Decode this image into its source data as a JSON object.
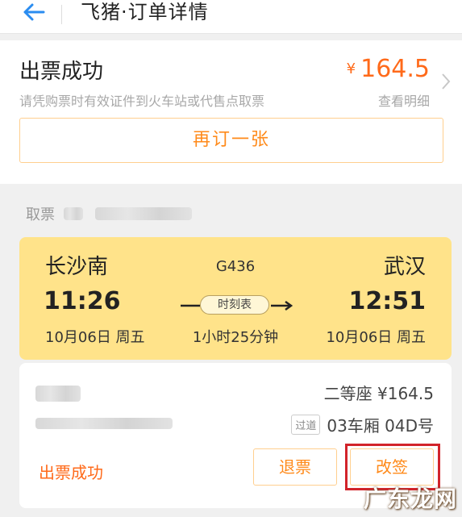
{
  "header": {
    "title": "飞猪·订单详情",
    "back_icon": "arrow-left-icon"
  },
  "status": {
    "title": "出票成功",
    "description": "请凭购票时有效证件到火车站或代售点取票",
    "currency": "¥",
    "price": "164.5",
    "detail_link": "查看明细",
    "rebook_label": "再订一张"
  },
  "pickup": {
    "label": "取票"
  },
  "train": {
    "from_station": "长沙南",
    "to_station": "武汉",
    "train_no": "G436",
    "departure_time": "11:26",
    "arrival_time": "12:51",
    "timetable_label": "时刻表",
    "departure_date": "10月06日 周五",
    "arrival_date": "10月06日 周五",
    "duration": "1小时25分钟"
  },
  "passenger": {
    "seat_price": "二等座 ¥164.5",
    "pass_badge": "过道",
    "car_seat": "03车厢 04D号",
    "ticket_status": "出票成功",
    "refund_label": "退票",
    "change_label": "改签"
  },
  "watermark": "广东龙网",
  "colors": {
    "accent": "#ff6a1a",
    "train_card": "#ffe38a",
    "highlight": "#d2232a",
    "back_icon": "#2a8cf0"
  }
}
